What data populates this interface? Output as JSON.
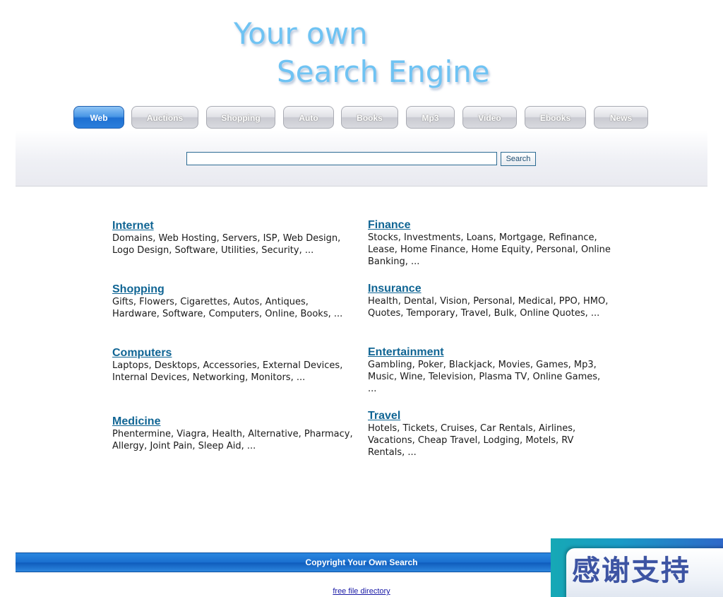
{
  "logo": {
    "line1": "Your own",
    "line2": "Search Engine"
  },
  "tabs": [
    {
      "label": "Web",
      "active": true
    },
    {
      "label": "Auctions",
      "active": false
    },
    {
      "label": "Shopping",
      "active": false
    },
    {
      "label": "Auto",
      "active": false
    },
    {
      "label": "Books",
      "active": false
    },
    {
      "label": "Mp3",
      "active": false
    },
    {
      "label": "Video",
      "active": false
    },
    {
      "label": "Ebooks",
      "active": false
    },
    {
      "label": "News",
      "active": false
    }
  ],
  "search": {
    "value": "",
    "button_label": "Search"
  },
  "categories": [
    {
      "title": "Internet",
      "desc": "Domains, Web Hosting, Servers, ISP, Web Design, Logo Design, Software, Utilities, Security,  ..."
    },
    {
      "title": "Finance",
      "desc": "Stocks, Investments, Loans, Mortgage, Refinance, Lease, Home Finance, Home Equity, Personal, Online Banking,  ..."
    },
    {
      "title": "Shopping",
      "desc": "Gifts, Flowers, Cigarettes, Autos, Antiques, Hardware, Software, Computers, Online, Books,  ..."
    },
    {
      "title": "Insurance",
      "desc": "Health, Dental, Vision, Personal, Medical, PPO, HMO, Quotes, Temporary, Travel, Bulk, Online Quotes,  ..."
    },
    {
      "title": "Computers",
      "desc": "Laptops, Desktops, Accessories, External Devices, Internal Devices, Networking, Monitors,  ..."
    },
    {
      "title": "Entertainment",
      "desc": "Gambling, Poker, Blackjack, Movies, Games, Mp3, Music, Wine, Television, Plasma TV, Online Games,  ..."
    },
    {
      "title": "Medicine",
      "desc": "Phentermine, Viagra, Health, Alternative, Pharmacy, Allergy, Joint Pain, Sleep Aid,  ..."
    },
    {
      "title": "Travel",
      "desc": "Hotels, Tickets, Cruises, Car Rentals, Airlines, Vacations, Cheap Travel, Lodging, Motels, RV Rentals,  ..."
    }
  ],
  "footer": {
    "copyright": "Copyright Your Own Search",
    "link": "free file directory"
  },
  "overlay": {
    "text": "感谢支持"
  },
  "colors": {
    "logo": "#6fc3f3",
    "link": "#106594",
    "active_tab": "#2b7edb",
    "footer_bar": "#1a6fcf"
  }
}
